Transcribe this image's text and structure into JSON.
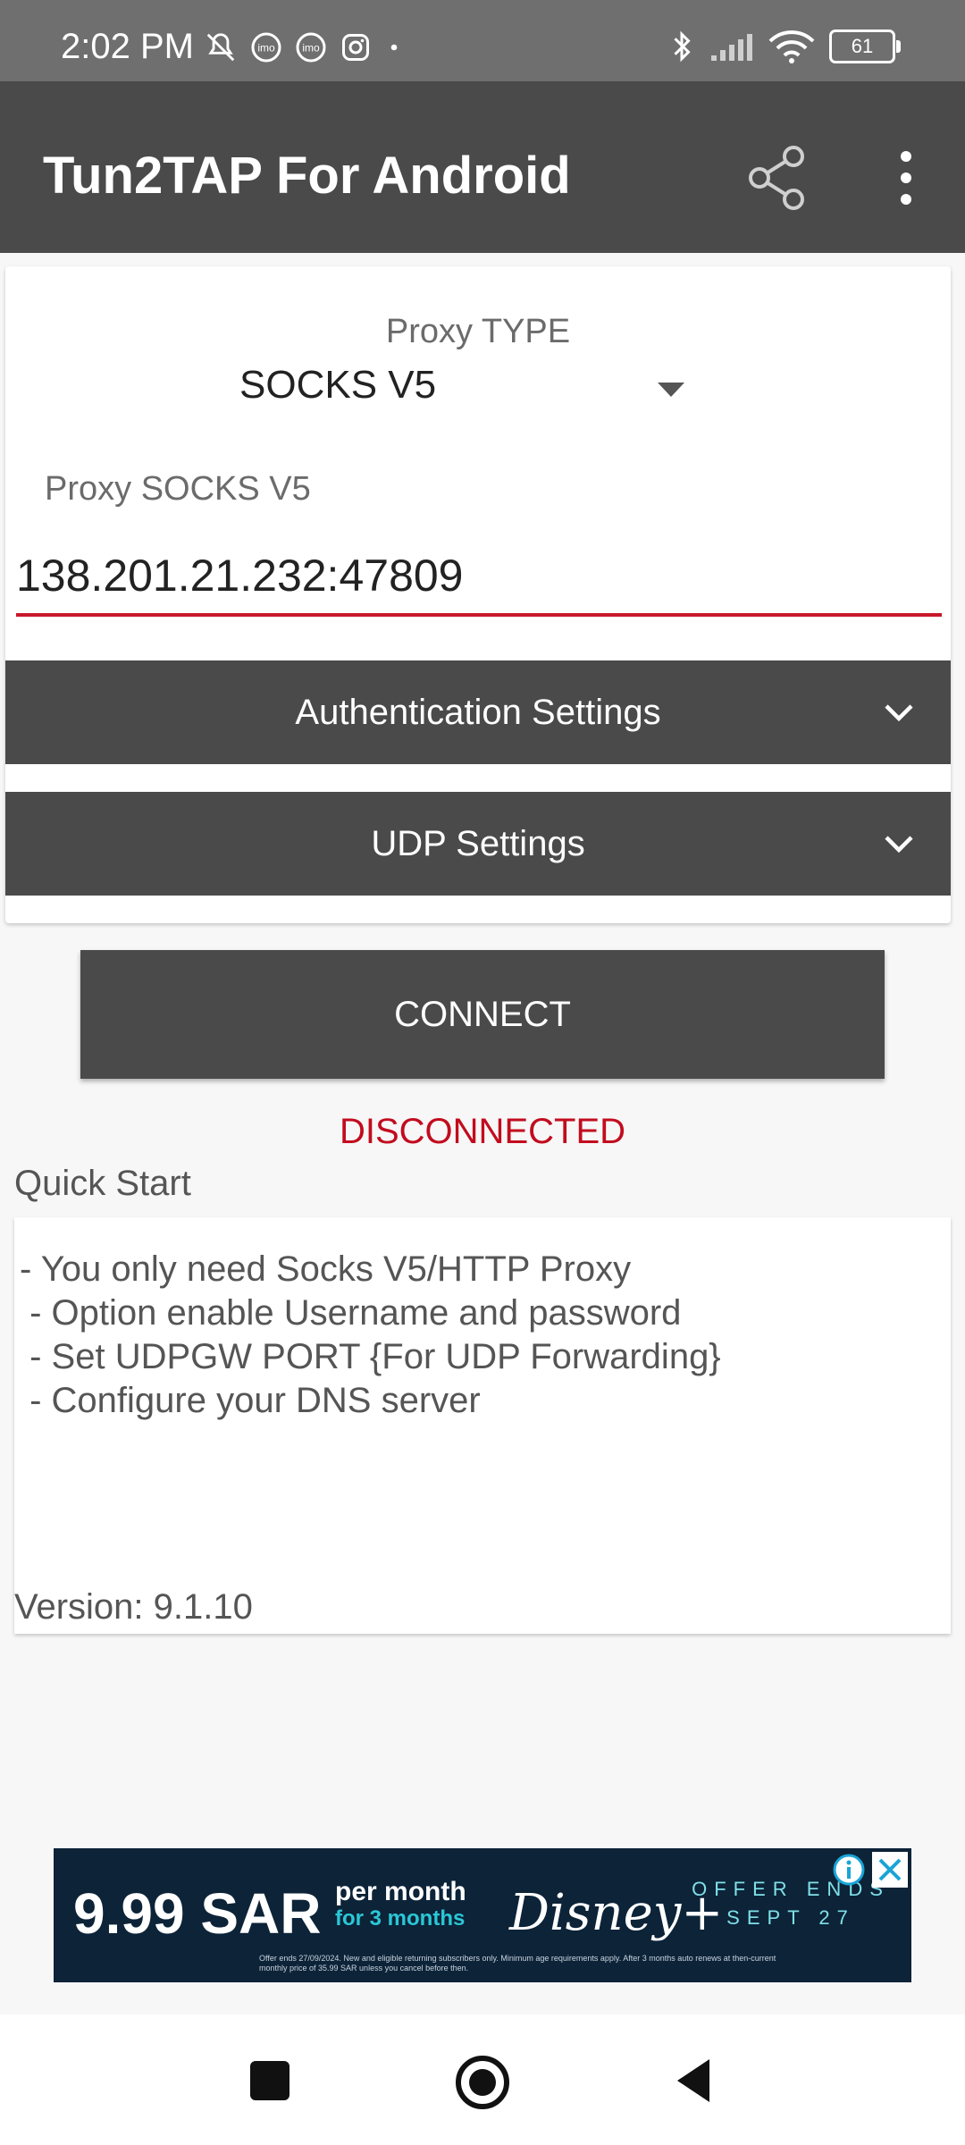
{
  "status_bar": {
    "time": "2:02 PM",
    "left_icons": [
      "muted-bell-icon",
      "imo-icon",
      "imo-icon",
      "instagram-icon",
      "dot-icon"
    ],
    "right_icons": [
      "bluetooth-icon",
      "signal-icon",
      "wifi-icon",
      "battery-icon"
    ],
    "battery": "61"
  },
  "app_bar": {
    "title": "Tun2TAP For Android",
    "share_icon": "share-icon",
    "menu_icon": "more-vert-icon"
  },
  "proxy": {
    "type_label": "Proxy TYPE",
    "type_value": "SOCKS V5",
    "field_label": "Proxy SOCKS V5",
    "field_value": "138.201.21.232:47809"
  },
  "sections": {
    "auth": "Authentication Settings",
    "udp": "UDP Settings"
  },
  "connect_label": "CONNECT",
  "status": "DISCONNECTED",
  "quick_start": {
    "title": "Quick Start",
    "lines": [
      "- You only need Socks V5/HTTP Proxy",
      " - Option enable Username and password",
      " - Set UDPGW PORT {For UDP Forwarding}",
      " - Configure your DNS server"
    ],
    "version": "Version: 9.1.10"
  },
  "ad": {
    "price": "9.99 SAR",
    "per_month": "per month",
    "duration": "for 3 months",
    "brand": "Disney+",
    "offer_line1": "OFFER ENDS",
    "offer_line2": "SEPT 27",
    "fine_print": "Offer ends 27/09/2024. New and eligible returning subscribers only. Minimum age requirements apply. After 3 months auto renews at then-current monthly price of 35.99 SAR unless you cancel before then."
  },
  "colors": {
    "app_bar": "#4a4a4a",
    "status_bar": "#6f6f6f",
    "accent_red": "#c8182a",
    "disconnected": "#c20c1e",
    "background": "#f7f7f7"
  }
}
